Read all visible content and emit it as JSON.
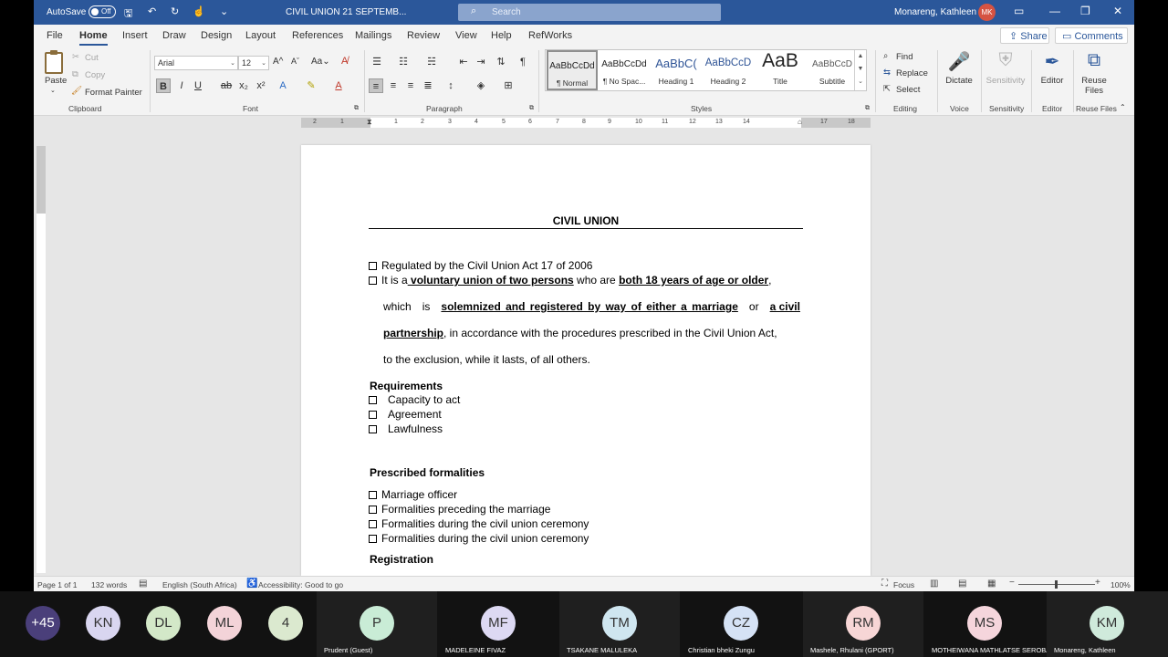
{
  "titlebar": {
    "autosave_label": "AutoSave",
    "autosave_state": "Off",
    "doc_title": "CIVIL UNION 21 SEPTEMB...",
    "search_placeholder": "Search",
    "user_name": "Monareng, Kathleen",
    "user_initials": "MK"
  },
  "tabs": [
    "File",
    "Home",
    "Insert",
    "Draw",
    "Design",
    "Layout",
    "References",
    "Mailings",
    "Review",
    "View",
    "Help",
    "RefWorks"
  ],
  "share_label": "Share",
  "comments_label": "Comments",
  "ribbon": {
    "clipboard": {
      "paste": "Paste",
      "cut": "Cut",
      "copy": "Copy",
      "format_painter": "Format Painter",
      "label": "Clipboard"
    },
    "font": {
      "name": "Arial",
      "size": "12",
      "label": "Font"
    },
    "paragraph": {
      "label": "Paragraph"
    },
    "styles": {
      "label": "Styles",
      "items": [
        {
          "preview": "AaBbCcDd",
          "name": "¶ Normal"
        },
        {
          "preview": "AaBbCcDd",
          "name": "¶ No Spac..."
        },
        {
          "preview": "AaBbC(",
          "name": "Heading 1"
        },
        {
          "preview": "AaBbCcD",
          "name": "Heading 2"
        },
        {
          "preview": "AaB",
          "name": "Title"
        },
        {
          "preview": "AaBbCcD",
          "name": "Subtitle"
        }
      ]
    },
    "editing": {
      "find": "Find",
      "replace": "Replace",
      "select": "Select",
      "label": "Editing"
    },
    "voice": {
      "dictate": "Dictate",
      "label": "Voice"
    },
    "sensitivity": {
      "button": "Sensitivity",
      "label": "Sensitivity"
    },
    "editor": {
      "button": "Editor",
      "label": "Editor"
    },
    "reuse": {
      "button_line1": "Reuse",
      "button_line2": "Files",
      "label": "Reuse Files"
    }
  },
  "ruler_numbers": [
    "2",
    "1",
    "1",
    "2",
    "3",
    "4",
    "5",
    "6",
    "7",
    "8",
    "9",
    "10",
    "11",
    "12",
    "13",
    "14",
    "15",
    "17",
    "18"
  ],
  "document": {
    "title": "CIVIL UNION",
    "bullet1": "Regulated by the Civil Union Act 17 of 2006",
    "p_it_is": "It is a",
    "p_voluntary": " voluntary union of two persons",
    "p_who_are": " who are ",
    "p_both18": "both 18 years of age or older",
    "p_comma": ",",
    "p_which": "which",
    "p_is": "is",
    "p_solemnized": "solemnized and registered by way of either a marriage",
    "p_or": "or",
    "p_a_civil": "a civil",
    "p_partnership": "partnership",
    "p_rest3": ", in accordance with the procedures prescribed in the Civil Union Act,",
    "p_line4": "to the exclusion, while it lasts, of all others.",
    "requirements_heading": "Requirements",
    "requirements": [
      "Capacity to act",
      "Agreement",
      "Lawfulness"
    ],
    "prescribed_heading": "Prescribed formalities",
    "formalities": [
      "Marriage officer",
      "Formalities preceding the marriage",
      "Formalities during the civil union ceremony",
      "Formalities during the civil union ceremony"
    ],
    "registration_heading": "Registration"
  },
  "statusbar": {
    "page": "Page 1 of 1",
    "words": "132 words",
    "language": "English (South Africa)",
    "accessibility": "Accessibility: Good to go",
    "focus": "Focus",
    "zoom": "100%"
  },
  "meeting": {
    "participants": [
      {
        "initials": "+45",
        "color": "#4a3f7a",
        "text_color": "#ffffff",
        "name": ""
      },
      {
        "initials": "KN",
        "color": "#d9d6f0",
        "text_color": "#333333",
        "name": ""
      },
      {
        "initials": "DL",
        "color": "#d3e8c8",
        "text_color": "#333333",
        "name": ""
      },
      {
        "initials": "ML",
        "color": "#f3d3d8",
        "text_color": "#333333",
        "name": ""
      },
      {
        "initials": "4",
        "color": "#dbe9cf",
        "text_color": "#333333",
        "name": ""
      },
      {
        "initials": "P",
        "color": "#c9ecd6",
        "text_color": "#333333",
        "name": "Prudent (Guest)"
      },
      {
        "initials": "MF",
        "color": "#ddd9f3",
        "text_color": "#333333",
        "name": "MADELEINE FIVAZ"
      },
      {
        "initials": "TM",
        "color": "#cfe6f0",
        "text_color": "#333333",
        "name": "TSAKANE MALULEKA"
      },
      {
        "initials": "CZ",
        "color": "#d5e2f5",
        "text_color": "#333333",
        "name": "Christian bheki Zungu"
      },
      {
        "initials": "RM",
        "color": "#f7d6d6",
        "text_color": "#333333",
        "name": "Mashele, Rhulani (GPORT)"
      },
      {
        "initials": "MS",
        "color": "#f5d5dc",
        "text_color": "#333333",
        "name": "MOTHEIWANA MATHLATSE SEROBA"
      },
      {
        "initials": "KM",
        "color": "#cfeadb",
        "text_color": "#333333",
        "name": "Monareng, Kathleen"
      }
    ]
  },
  "colors": {
    "word_blue": "#2b579a",
    "avatar_red": "#d55342"
  }
}
